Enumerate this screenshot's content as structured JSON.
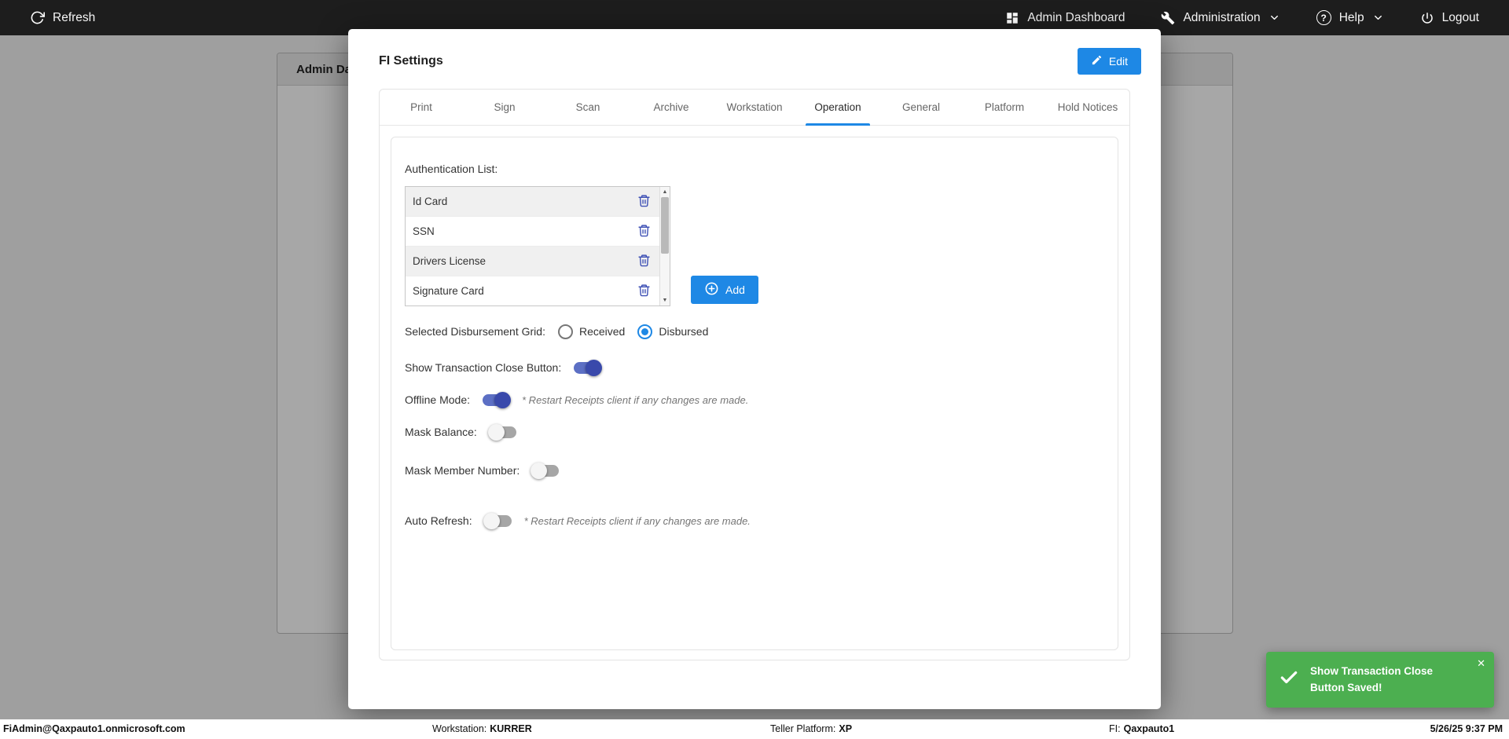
{
  "topbar": {
    "refresh_label": "Refresh",
    "admin_dashboard_label": "Admin Dashboard",
    "administration_label": "Administration",
    "help_label": "Help",
    "logout_label": "Logout"
  },
  "background_page": {
    "panel_title": "Admin Dashboard"
  },
  "modal": {
    "title": "FI Settings",
    "edit_button_label": "Edit",
    "tabs": [
      {
        "label": "Print",
        "active": false
      },
      {
        "label": "Sign",
        "active": false
      },
      {
        "label": "Scan",
        "active": false
      },
      {
        "label": "Archive",
        "active": false
      },
      {
        "label": "Workstation",
        "active": false
      },
      {
        "label": "Operation",
        "active": true
      },
      {
        "label": "General",
        "active": false
      },
      {
        "label": "Platform",
        "active": false
      },
      {
        "label": "Hold Notices",
        "active": false
      }
    ],
    "operation_tab": {
      "auth_list_label": "Authentication List:",
      "auth_items": [
        "Id Card",
        "SSN",
        "Drivers License",
        "Signature Card"
      ],
      "add_button_label": "Add",
      "disbursement_label": "Selected Disbursement Grid:",
      "disbursement_options": [
        {
          "label": "Received",
          "selected": false
        },
        {
          "label": "Disbursed",
          "selected": true
        }
      ],
      "toggles": [
        {
          "label": "Show Transaction Close Button:",
          "on": true,
          "note": ""
        },
        {
          "label": "Offline Mode:",
          "on": true,
          "note": "* Restart Receipts client if any changes are made."
        },
        {
          "label": "Mask Balance:",
          "on": false,
          "note": ""
        },
        {
          "label": "Mask Member Number:",
          "on": false,
          "note": ""
        },
        {
          "label": "Auto Refresh:",
          "on": false,
          "note": "* Restart Receipts client if any changes are made."
        }
      ]
    }
  },
  "footer": {
    "user": "FiAdmin@Qaxpauto1.onmicrosoft.com",
    "workstation_label": "Workstation:",
    "workstation_value": "KURRER",
    "teller_platform_label": "Teller Platform:",
    "teller_platform_value": "XP",
    "fi_label": "FI:",
    "fi_value": "Qaxpauto1",
    "datetime": "5/26/25 9:37 PM"
  },
  "toast": {
    "message": "Show Transaction Close Button Saved!",
    "close_glyph": "✕"
  },
  "colors": {
    "primary_blue": "#1e88e5",
    "switch_on_blue": "#3949ab",
    "toast_green": "#4caf50",
    "topbar_bg": "#1d1d1d"
  }
}
